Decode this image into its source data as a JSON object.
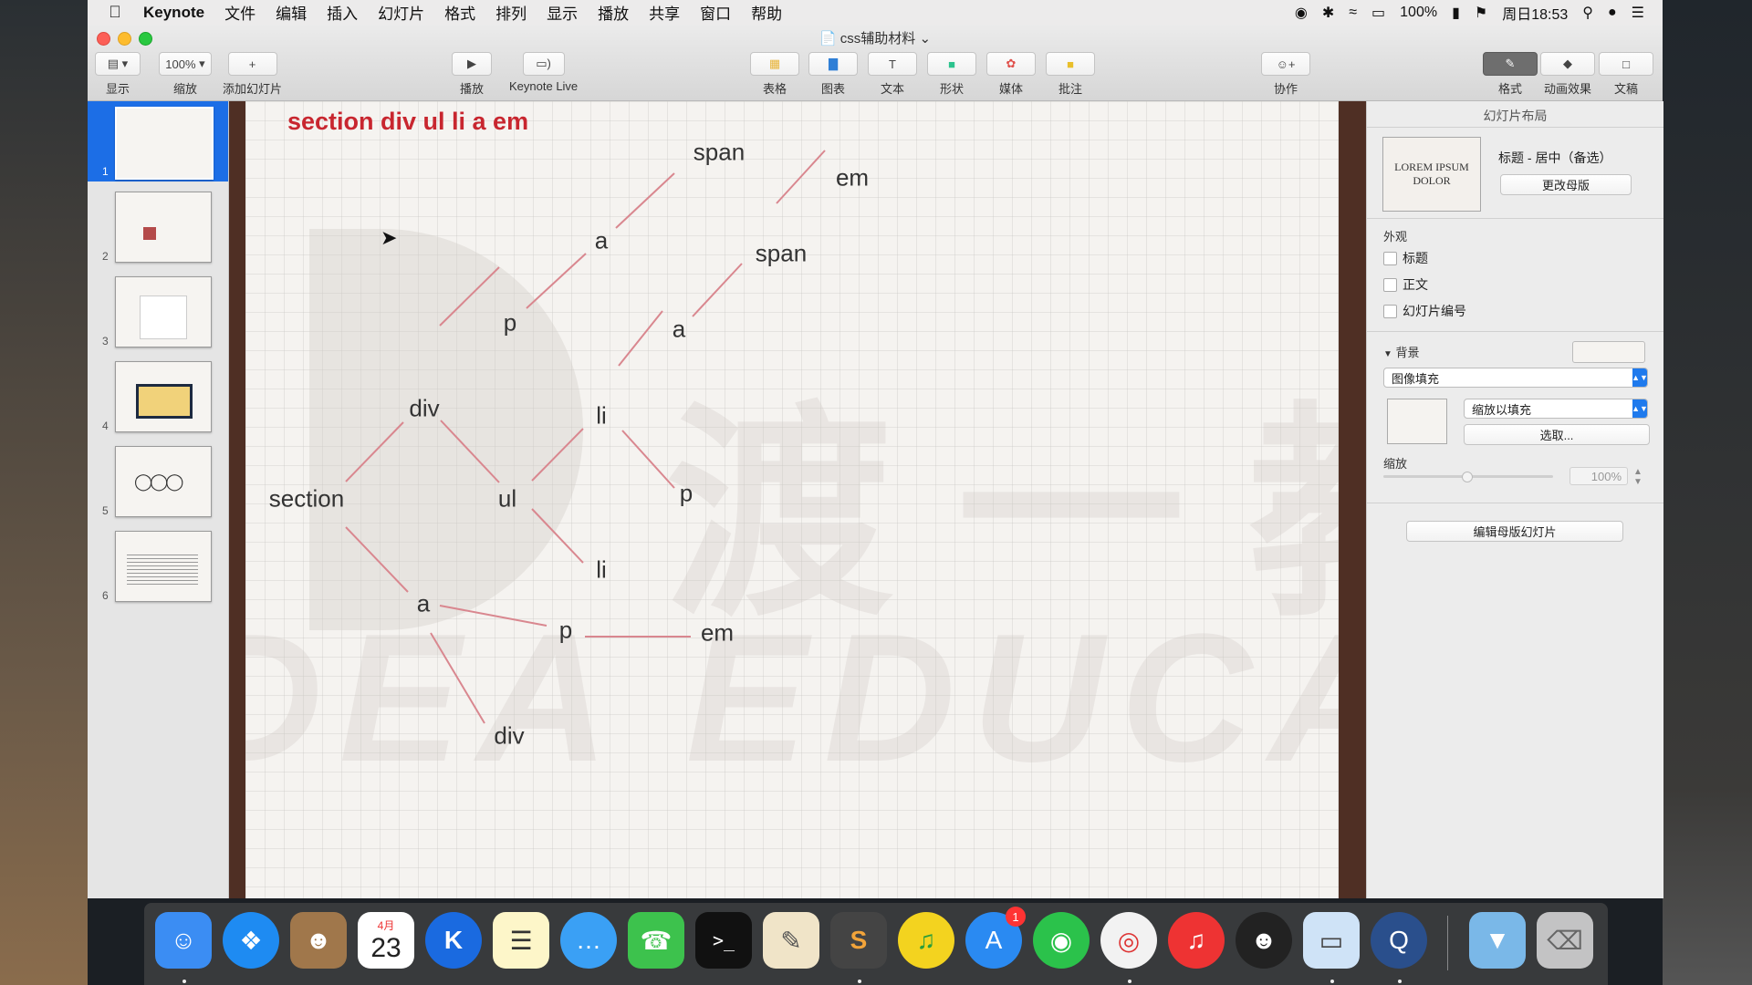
{
  "menubar": {
    "app_name": "Keynote",
    "items": [
      "文件",
      "编辑",
      "插入",
      "幻灯片",
      "格式",
      "排列",
      "显示",
      "播放",
      "共享",
      "窗口",
      "帮助"
    ],
    "battery": "100%",
    "clock": "周日18:53"
  },
  "window": {
    "doc_title": "css辅助材料"
  },
  "toolbar": {
    "view_label": "显示",
    "zoom_value": "100%",
    "zoom_label": "缩放",
    "add_slide_label": "添加幻灯片",
    "play_label": "播放",
    "keynote_live_label": "Keynote Live",
    "table_label": "表格",
    "chart_label": "图表",
    "text_label": "文本",
    "shape_label": "形状",
    "media_label": "媒体",
    "comment_label": "批注",
    "collab_label": "协作",
    "format_label": "格式",
    "animate_label": "动画效果",
    "document_label": "文稿"
  },
  "navigator": {
    "slides": [
      "1",
      "2",
      "3",
      "4",
      "5",
      "6"
    ],
    "selected": 1
  },
  "slide": {
    "title": "section div ul li a em",
    "nodes": {
      "span1": "span",
      "em1": "em",
      "a1": "a",
      "span2": "span",
      "p1": "p",
      "a2": "a",
      "div1": "div",
      "li1": "li",
      "section": "section",
      "ul": "ul",
      "p2": "p",
      "li2": "li",
      "a3": "a",
      "p3": "p",
      "em2": "em",
      "div2": "div"
    },
    "line_color": "#d9878f"
  },
  "inspector": {
    "title": "幻灯片布局",
    "layout_thumb_text": "LOREM IPSUM DOLOR",
    "layout_name": "标题 - 居中（备选）",
    "change_master_label": "更改母版",
    "appearance_label": "外观",
    "check_title": "标题",
    "check_body": "正文",
    "check_slide_number": "幻灯片编号",
    "background_label": "背景",
    "fill_type": "图像填充",
    "scale_mode": "缩放以填充",
    "choose_label": "选取...",
    "scale_label": "缩放",
    "scale_value": "100%",
    "edit_master_label": "编辑母版幻灯片"
  },
  "dock": {
    "calendar_month": "4月",
    "calendar_day": "23",
    "appstore_badge": "1"
  }
}
